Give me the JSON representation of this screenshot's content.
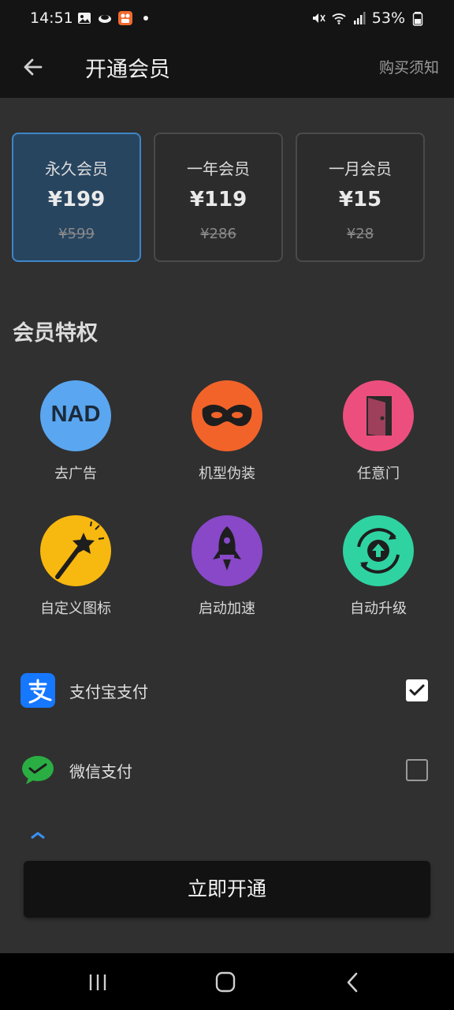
{
  "status_bar": {
    "time": "14:51",
    "battery": "53%",
    "icons_left": [
      "image-icon",
      "cloud-icon",
      "app-icon",
      "dot-icon"
    ],
    "icons_right": [
      "mute-icon",
      "wifi-icon",
      "signal-icon",
      "battery-icon"
    ]
  },
  "header": {
    "title": "开通会员",
    "notice_link": "购买须知"
  },
  "plans": [
    {
      "name": "永久会员",
      "price": "¥199",
      "original_price": "¥599",
      "selected": true
    },
    {
      "name": "一年会员",
      "price": "¥119",
      "original_price": "¥286",
      "selected": false
    },
    {
      "name": "一月会员",
      "price": "¥15",
      "original_price": "¥28",
      "selected": false
    }
  ],
  "privileges": {
    "title": "会员特权",
    "items": [
      {
        "label": "去广告",
        "icon": "nad-icon",
        "badge_text": "NAD"
      },
      {
        "label": "机型伪装",
        "icon": "mask-icon"
      },
      {
        "label": "任意门",
        "icon": "door-icon"
      },
      {
        "label": "自定义图标",
        "icon": "magic-wand-icon"
      },
      {
        "label": "启动加速",
        "icon": "rocket-icon"
      },
      {
        "label": "自动升级",
        "icon": "upgrade-icon"
      }
    ]
  },
  "payment": {
    "methods": [
      {
        "label": "支付宝支付",
        "icon": "alipay-icon",
        "checked": true
      },
      {
        "label": "微信支付",
        "icon": "wechat-icon",
        "checked": false
      }
    ]
  },
  "cta": {
    "label": "立即开通"
  },
  "nav_bar": {
    "buttons": [
      "recents-icon",
      "home-icon",
      "back-icon"
    ]
  },
  "colors": {
    "selected_plan_bg": "#284560",
    "selected_plan_border": "#3d86c6",
    "page_bg": "#303030",
    "header_bg": "#141414"
  }
}
